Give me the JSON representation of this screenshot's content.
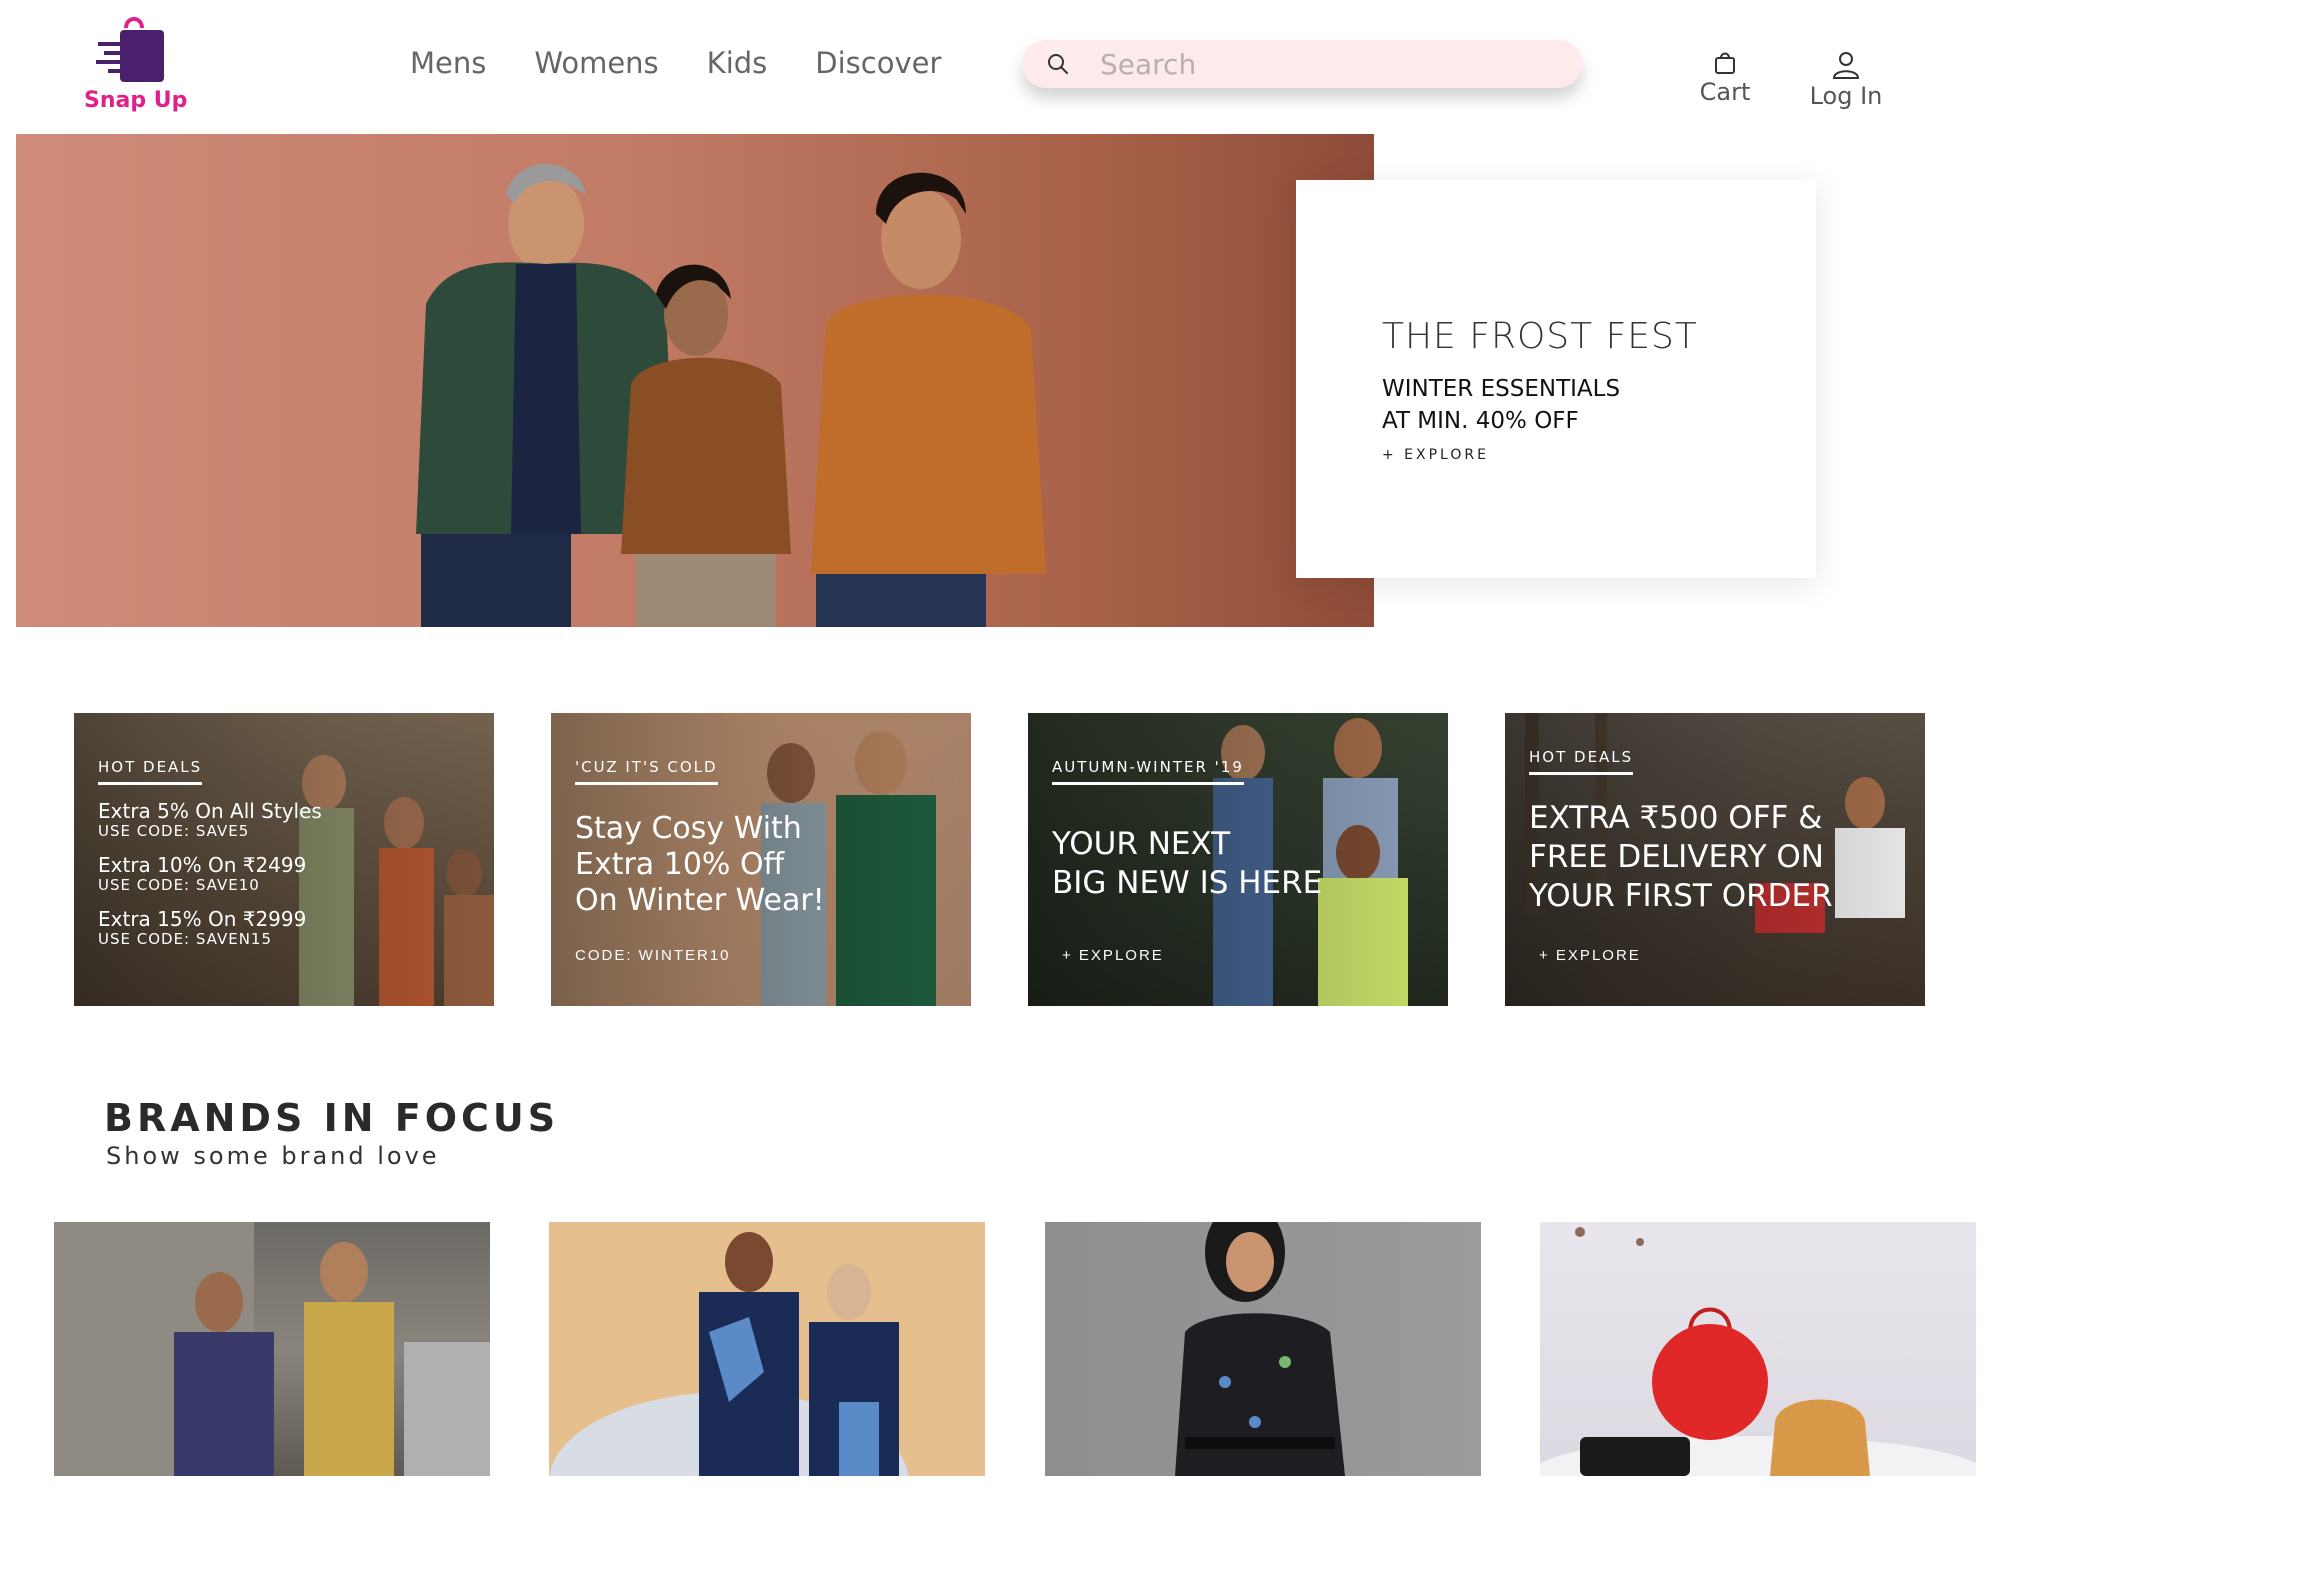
{
  "header": {
    "logo_text": "Snap Up",
    "nav": [
      {
        "label": "Mens"
      },
      {
        "label": "Womens"
      },
      {
        "label": "Kids"
      },
      {
        "label": "Discover"
      }
    ],
    "search_placeholder": "Search",
    "cart_label": "Cart",
    "login_label": "Log In"
  },
  "hero": {
    "title": "THE FROST FEST",
    "subtitle_line1": "WINTER ESSENTIALS",
    "subtitle_line2": "AT MIN. 40% OFF",
    "link": "+ EXPLORE"
  },
  "promos": [
    {
      "tag": "HOT DEALS",
      "deals": [
        {
          "offer": "Extra 5% On All Styles",
          "code": "USE CODE: SAVE5"
        },
        {
          "offer": "Extra 10% On ₹2499",
          "code": "USE CODE: SAVE10"
        },
        {
          "offer": "Extra 15% On ₹2999",
          "code": "USE CODE: SAVEN15"
        }
      ]
    },
    {
      "tag": "'CUZ IT'S COLD",
      "line1": "Stay Cosy With",
      "line2": "Extra 10% Off",
      "line3": "On Winter Wear!",
      "code": "CODE: WINTER10"
    },
    {
      "tag": "AUTUMN-WINTER '19",
      "line1": "YOUR NEXT",
      "line2": "BIG NEW IS HERE",
      "link": "+ EXPLORE"
    },
    {
      "tag": "HOT DEALS",
      "line1": "EXTRA ₹500 OFF &",
      "line2": "FREE DELIVERY ON",
      "line3": "YOUR FIRST ORDER",
      "link": "+ EXPLORE"
    }
  ],
  "brands": {
    "title": "BRANDS IN FOCUS",
    "subtitle": "Show some brand love"
  },
  "colors": {
    "brand_pink": "#e0208a",
    "brand_purple": "#4a1f6e",
    "search_bg": "#fdebeb",
    "hero_bg": "#c27b66"
  }
}
